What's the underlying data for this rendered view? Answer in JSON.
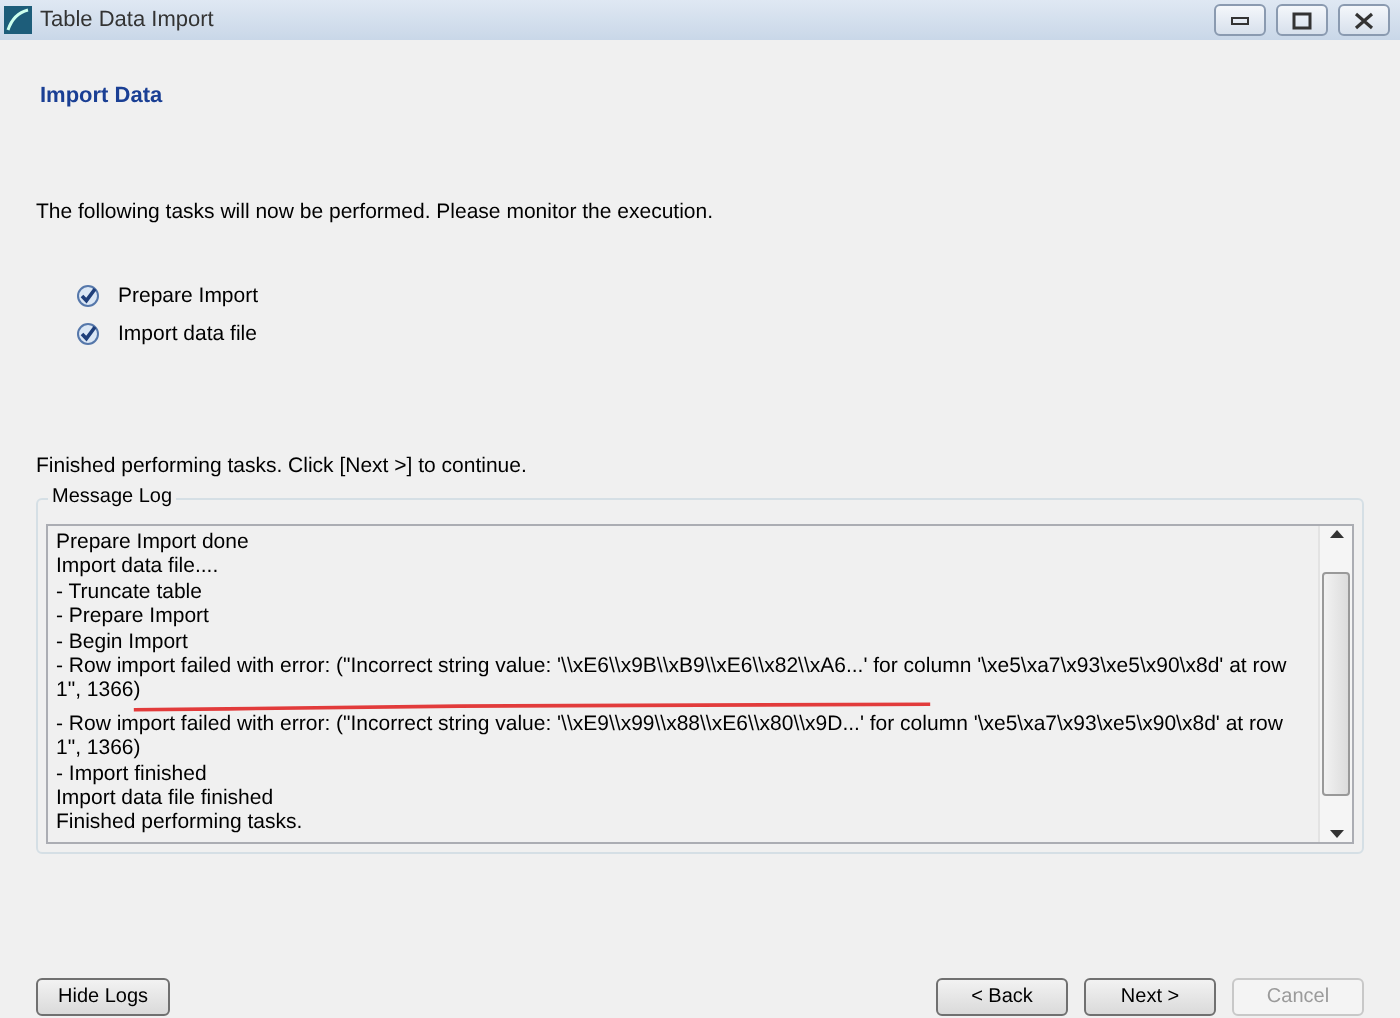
{
  "window": {
    "title": "Table Data Import"
  },
  "header": "Import Data",
  "intro": "The following tasks will now be performed. Please monitor the execution.",
  "tasks": [
    {
      "label": "Prepare Import",
      "checked": true
    },
    {
      "label": "Import data file",
      "checked": true
    }
  ],
  "status": "Finished performing tasks. Click [Next >] to continue.",
  "message_log": {
    "title": "Message Log",
    "lines": [
      {
        "text": "Prepare Import done",
        "underlined": false
      },
      {
        "text": "Import data file....",
        "underlined": false
      },
      {
        "text": "- Truncate table",
        "underlined": false
      },
      {
        "text": "- Prepare Import",
        "underlined": false
      },
      {
        "text": "- Begin Import",
        "underlined": false
      },
      {
        "text": "- Row import failed with error: (\"Incorrect string value: '\\\\xE6\\\\x9B\\\\xB9\\\\xE6\\\\x82\\\\xA6...' for column '\\xe5\\xa7\\x93\\xe5\\x90\\x8d' at row 1\", 1366)",
        "underlined": true
      },
      {
        "text": "- Row import failed with error: (\"Incorrect string value: '\\\\xE9\\\\x99\\\\x88\\\\xE6\\\\x80\\\\x9D...' for column '\\xe5\\xa7\\x93\\xe5\\x90\\x8d' at row 1\", 1366)",
        "underlined": false
      },
      {
        "text": "- Import finished",
        "underlined": false
      },
      {
        "text": "Import data file finished",
        "underlined": false
      },
      {
        "text": "Finished performing tasks.",
        "underlined": false
      }
    ]
  },
  "buttons": [
    {
      "label": "Hide Logs",
      "disabled": false
    },
    {
      "label": "< Back",
      "disabled": false
    },
    {
      "label": "Next >",
      "disabled": false
    },
    {
      "label": "Cancel",
      "disabled": true
    }
  ]
}
